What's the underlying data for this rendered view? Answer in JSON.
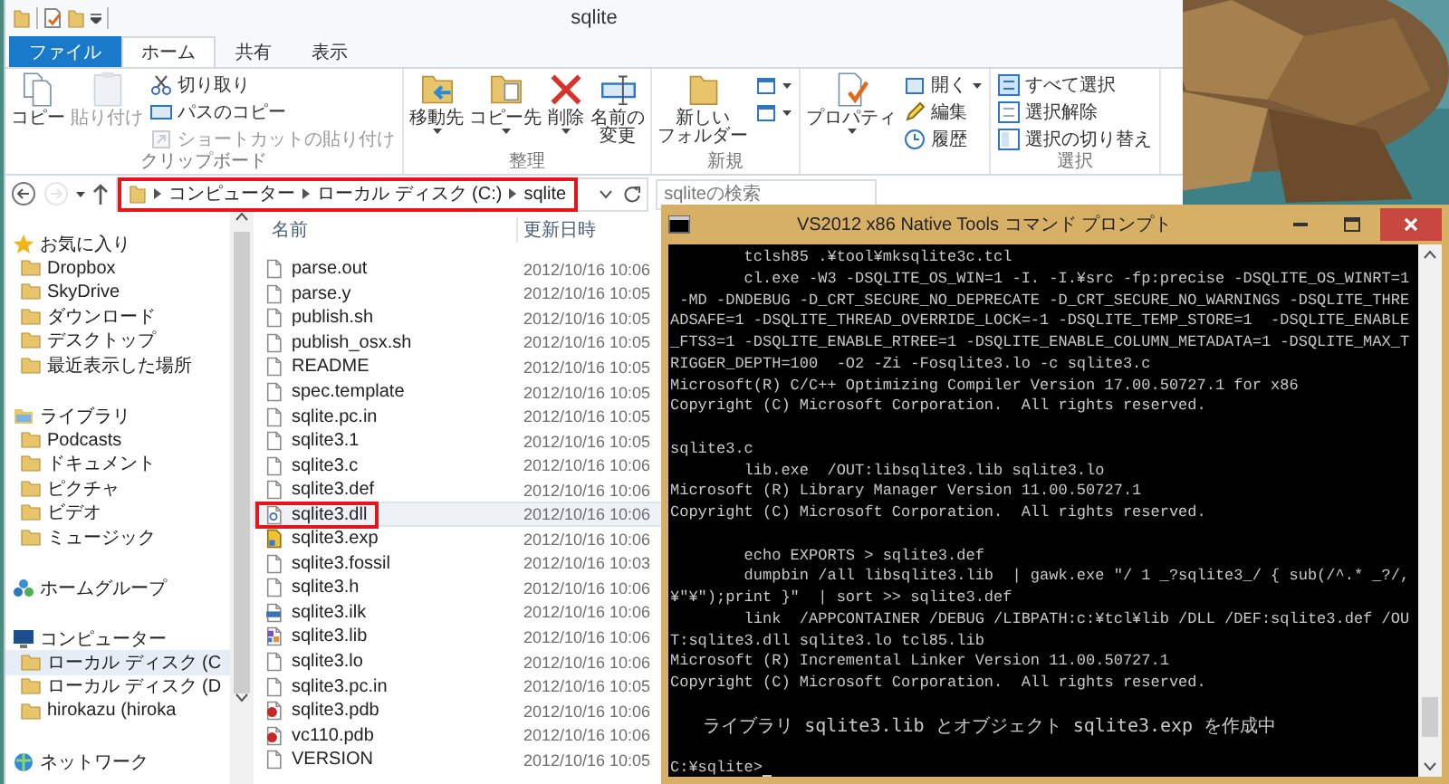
{
  "explorer": {
    "title": "sqlite",
    "tabs": [
      {
        "label": "ファイル",
        "kind": "file",
        "selected": false
      },
      {
        "label": "ホーム",
        "kind": "tab",
        "selected": true
      },
      {
        "label": "共有",
        "kind": "tab",
        "selected": false
      },
      {
        "label": "表示",
        "kind": "tab",
        "selected": false
      }
    ],
    "ribbon": [
      {
        "label": "クリップボード",
        "items": [
          {
            "kind": "large",
            "lines": [
              "コピー"
            ],
            "disabled": false
          },
          {
            "kind": "large",
            "lines": [
              "貼り付け"
            ],
            "disabled": true
          },
          {
            "kind": "small",
            "label": "切り取り",
            "disabled": false
          },
          {
            "kind": "small",
            "label": "パスのコピー",
            "disabled": false
          },
          {
            "kind": "small",
            "label": "ショートカットの貼り付け",
            "disabled": true
          }
        ]
      },
      {
        "label": "整理",
        "items": [
          {
            "kind": "large",
            "lines": [
              "移動先"
            ],
            "disabled": false,
            "dropdown": true
          },
          {
            "kind": "large",
            "lines": [
              "コピー先"
            ],
            "disabled": false,
            "dropdown": true
          },
          {
            "kind": "large",
            "lines": [
              "削除"
            ],
            "disabled": false,
            "dropdown": true
          },
          {
            "kind": "large",
            "lines": [
              "名前の",
              "変更"
            ],
            "disabled": false
          }
        ]
      },
      {
        "label": "新規",
        "items": [
          {
            "kind": "large",
            "lines": [
              "新しい",
              "フォルダー"
            ],
            "disabled": false
          },
          {
            "kind": "icon",
            "dropdown": true
          },
          {
            "kind": "icon",
            "dropdown": true
          }
        ]
      },
      {
        "items": [
          {
            "kind": "large",
            "lines": [
              "プロパティ"
            ],
            "disabled": false,
            "dropdown": true
          },
          {
            "kind": "small",
            "label": "開く",
            "disabled": false,
            "dropdown": true
          },
          {
            "kind": "small",
            "label": "編集",
            "disabled": false
          },
          {
            "kind": "small",
            "label": "履歴",
            "disabled": false
          }
        ]
      },
      {
        "label": "選択",
        "items": [
          {
            "kind": "small",
            "label": "すべて選択",
            "disabled": false
          },
          {
            "kind": "small",
            "label": "選択解除",
            "disabled": false
          },
          {
            "kind": "small",
            "label": "選択の切り替え",
            "disabled": false
          }
        ]
      }
    ],
    "address": {
      "back_disabled": false,
      "forward_disabled": true,
      "crumbs": [
        "コンピューター",
        "ローカル ディスク (C:)",
        "sqlite"
      ],
      "annotated": true
    },
    "search": {
      "placeholder": "sqliteの検索"
    },
    "nav": [
      {
        "label": "お気に入り",
        "selected": false,
        "children": [
          {
            "label": "Dropbox",
            "selected": false
          },
          {
            "label": "SkyDrive",
            "selected": false
          },
          {
            "label": "ダウンロード",
            "selected": false
          },
          {
            "label": "デスクトップ",
            "selected": false
          },
          {
            "label": "最近表示した場所",
            "selected": false
          }
        ]
      },
      {
        "label": "ライブラリ",
        "selected": false,
        "children": [
          {
            "label": "Podcasts",
            "selected": false
          },
          {
            "label": "ドキュメント",
            "selected": false
          },
          {
            "label": "ピクチャ",
            "selected": false
          },
          {
            "label": "ビデオ",
            "selected": false
          },
          {
            "label": "ミュージック",
            "selected": false
          }
        ]
      },
      {
        "label": "ホームグループ",
        "selected": false
      },
      {
        "label": "コンピューター",
        "selected": false,
        "children": [
          {
            "label": "ローカル ディスク (C",
            "selected": true
          },
          {
            "label": "ローカル ディスク (D",
            "selected": false
          },
          {
            "label": "hirokazu (hiroka",
            "selected": false
          }
        ]
      },
      {
        "label": "ネットワーク",
        "selected": false
      }
    ],
    "columns": [
      "名前",
      "更新日時"
    ],
    "files": [
      {
        "name": "parse.out",
        "modified": "2012/10/16 10:06",
        "kind": "doc",
        "selected": false,
        "annotated": false
      },
      {
        "name": "parse.y",
        "modified": "2012/10/16 10:05",
        "kind": "doc",
        "selected": false,
        "annotated": false
      },
      {
        "name": "publish.sh",
        "modified": "2012/10/16 10:05",
        "kind": "doc",
        "selected": false,
        "annotated": false
      },
      {
        "name": "publish_osx.sh",
        "modified": "2012/10/16 10:05",
        "kind": "doc",
        "selected": false,
        "annotated": false
      },
      {
        "name": "README",
        "modified": "2012/10/16 10:05",
        "kind": "doc",
        "selected": false,
        "annotated": false
      },
      {
        "name": "spec.template",
        "modified": "2012/10/16 10:05",
        "kind": "doc",
        "selected": false,
        "annotated": false
      },
      {
        "name": "sqlite.pc.in",
        "modified": "2012/10/16 10:05",
        "kind": "doc",
        "selected": false,
        "annotated": false
      },
      {
        "name": "sqlite3.1",
        "modified": "2012/10/16 10:05",
        "kind": "doc",
        "selected": false,
        "annotated": false
      },
      {
        "name": "sqlite3.c",
        "modified": "2012/10/16 10:06",
        "kind": "doc",
        "selected": false,
        "annotated": false
      },
      {
        "name": "sqlite3.def",
        "modified": "2012/10/16 10:06",
        "kind": "doc",
        "selected": false,
        "annotated": false
      },
      {
        "name": "sqlite3.dll",
        "modified": "2012/10/16 10:06",
        "kind": "dll",
        "selected": true,
        "annotated": true
      },
      {
        "name": "sqlite3.exp",
        "modified": "2012/10/16 10:06",
        "kind": "exp",
        "selected": false,
        "annotated": false
      },
      {
        "name": "sqlite3.fossil",
        "modified": "2012/10/16 10:03",
        "kind": "doc",
        "selected": false,
        "annotated": false
      },
      {
        "name": "sqlite3.h",
        "modified": "2012/10/16 10:06",
        "kind": "doc",
        "selected": false,
        "annotated": false
      },
      {
        "name": "sqlite3.ilk",
        "modified": "2012/10/16 10:06",
        "kind": "ilk",
        "selected": false,
        "annotated": false
      },
      {
        "name": "sqlite3.lib",
        "modified": "2012/10/16 10:06",
        "kind": "lib",
        "selected": false,
        "annotated": false
      },
      {
        "name": "sqlite3.lo",
        "modified": "2012/10/16 10:06",
        "kind": "doc",
        "selected": false,
        "annotated": false
      },
      {
        "name": "sqlite3.pc.in",
        "modified": "2012/10/16 10:05",
        "kind": "doc",
        "selected": false,
        "annotated": false
      },
      {
        "name": "sqlite3.pdb",
        "modified": "2012/10/16 10:06",
        "kind": "pdb",
        "selected": false,
        "annotated": false
      },
      {
        "name": "vc110.pdb",
        "modified": "2012/10/16 10:06",
        "kind": "pdb",
        "selected": false,
        "annotated": false
      },
      {
        "name": "VERSION",
        "modified": "2012/10/16 10:05",
        "kind": "doc",
        "selected": false,
        "annotated": false
      }
    ]
  },
  "console": {
    "title": "VS2012 x86 Native Tools コマンド プロンプト",
    "lines": [
      {
        "kind": "text",
        "text": "        tclsh85 .¥tool¥mksqlite3c.tcl"
      },
      {
        "kind": "text",
        "text": "        cl.exe -W3 -DSQLITE_OS_WIN=1 -I. -I.¥src -fp:precise -DSQLITE_OS_WINRT=1"
      },
      {
        "kind": "text",
        "text": " -MD -DNDEBUG -D_CRT_SECURE_NO_DEPRECATE -D_CRT_SECURE_NO_WARNINGS -DSQLITE_THRE"
      },
      {
        "kind": "text",
        "text": "ADSAFE=1 -DSQLITE_THREAD_OVERRIDE_LOCK=-1 -DSQLITE_TEMP_STORE=1  -DSQLITE_ENABLE"
      },
      {
        "kind": "text",
        "text": "_FTS3=1 -DSQLITE_ENABLE_RTREE=1 -DSQLITE_ENABLE_COLUMN_METADATA=1 -DSQLITE_MAX_T"
      },
      {
        "kind": "text",
        "text": "RIGGER_DEPTH=100  -O2 -Zi -Fosqlite3.lo -c sqlite3.c"
      },
      {
        "kind": "text",
        "text": "Microsoft(R) C/C++ Optimizing Compiler Version 17.00.50727.1 for x86"
      },
      {
        "kind": "text",
        "text": "Copyright (C) Microsoft Corporation.  All rights reserved."
      },
      {
        "kind": "blank"
      },
      {
        "kind": "text",
        "text": "sqlite3.c"
      },
      {
        "kind": "text",
        "text": "        lib.exe  /OUT:libsqlite3.lib sqlite3.lo"
      },
      {
        "kind": "text",
        "text": "Microsoft (R) Library Manager Version 11.00.50727.1"
      },
      {
        "kind": "text",
        "text": "Copyright (C) Microsoft Corporation.  All rights reserved."
      },
      {
        "kind": "blank"
      },
      {
        "kind": "text",
        "text": "        echo EXPORTS > sqlite3.def"
      },
      {
        "kind": "text",
        "text": "        dumpbin /all libsqlite3.lib  | gawk.exe \"/ 1 _?sqlite3_/ { sub(/^.* _?/,"
      },
      {
        "kind": "text",
        "text": "¥\"¥\");print }\"  | sort >> sqlite3.def"
      },
      {
        "kind": "text",
        "text": "        link  /APPCONTAINER /DEBUG /LIBPATH:c:¥tcl¥lib /DLL /DEF:sqlite3.def /OU"
      },
      {
        "kind": "text",
        "text": "T:sqlite3.dll sqlite3.lo tcl85.lib"
      },
      {
        "kind": "text",
        "text": "Microsoft (R) Incremental Linker Version 11.00.50727.1"
      },
      {
        "kind": "text",
        "text": "Copyright (C) Microsoft Corporation.  All rights reserved."
      },
      {
        "kind": "blank"
      },
      {
        "kind": "wide",
        "text": "   ライブラリ sqlite3.lib とオブジェクト sqlite3.exp を作成中"
      },
      {
        "kind": "blank"
      },
      {
        "kind": "prompt",
        "text": "C:¥sqlite>"
      }
    ]
  }
}
